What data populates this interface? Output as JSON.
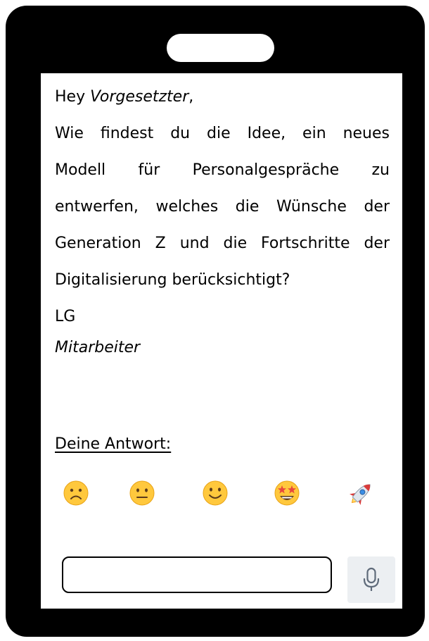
{
  "message": {
    "greeting": "Hey ",
    "recipient": "Vorgesetzter",
    "greeting_punct": ",",
    "lines": [
      "Wie findest du die Idee, ein neues",
      "Modell für Personalgespräche zu",
      "entwerfen, welches die Wünsche der",
      "Generation Z und die Fortschritte der",
      "Digitalisierung berücksichtigt?"
    ],
    "closing": "LG",
    "sender": "Mitarbeiter"
  },
  "reply": {
    "label": "Deine Antwort:",
    "emojis": [
      "frowning-face",
      "neutral-face",
      "smiling-face",
      "star-struck-face",
      "rocket"
    ],
    "input_value": "",
    "input_placeholder": ""
  },
  "colors": {
    "frame": "#000000",
    "screen": "#ffffff",
    "emoji_yellow": "#ffc83d",
    "mic_background": "#eceff2"
  }
}
